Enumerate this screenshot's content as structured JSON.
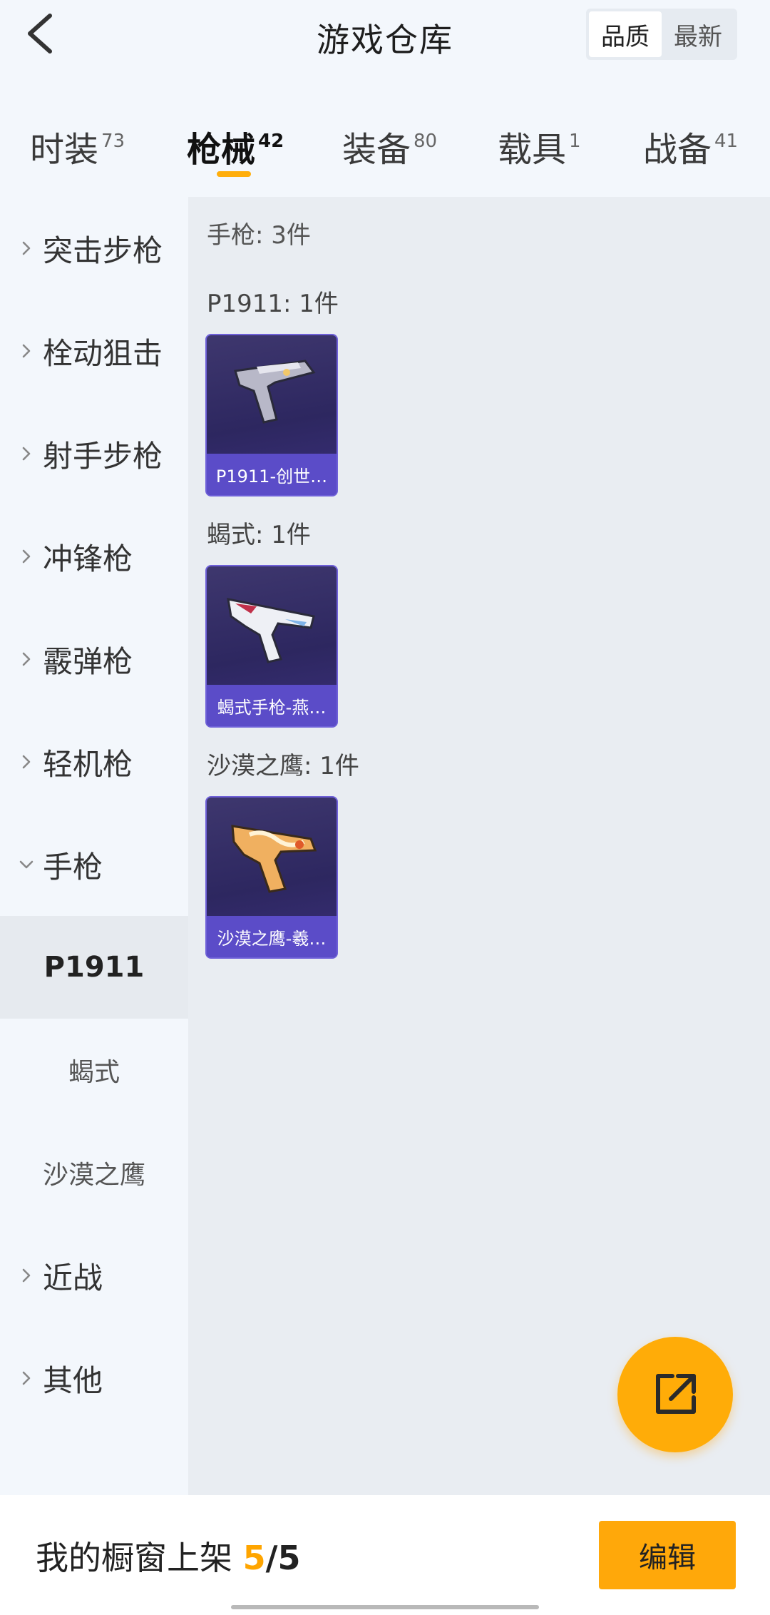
{
  "header": {
    "title": "游戏仓库",
    "sort_options": [
      "品质",
      "最新"
    ]
  },
  "tabs": [
    {
      "label": "时装",
      "count": "73"
    },
    {
      "label": "枪械",
      "count": "42"
    },
    {
      "label": "装备",
      "count": "80"
    },
    {
      "label": "载具",
      "count": "1"
    },
    {
      "label": "战备",
      "count": "41"
    }
  ],
  "sidebar": {
    "categories": [
      "突击步枪",
      "栓动狙击",
      "射手步枪",
      "冲锋枪",
      "霰弹枪",
      "轻机枪",
      "手枪"
    ],
    "subcategories": [
      "P1911",
      "蝎式",
      "沙漠之鹰"
    ],
    "bottom_categories": [
      "近战",
      "其他"
    ]
  },
  "content": {
    "section_title": "手枪: 3件",
    "groups": [
      {
        "title": "P1911: 1件",
        "item_label": "P1911-创世…"
      },
      {
        "title": "蝎式: 1件",
        "item_label": "蝎式手枪-燕…"
      },
      {
        "title": "沙漠之鹰: 1件",
        "item_label": "沙漠之鹰-羲…"
      }
    ]
  },
  "bottom_bar": {
    "showcase_label": "我的橱窗上架",
    "current": "5",
    "separator": "/",
    "total": "5",
    "edit_label": "编辑"
  },
  "colors": {
    "accent": "#ffac08",
    "card_bg": "#2d2760",
    "card_label_bg": "#5b4cc8",
    "content_bg": "#e9edf2"
  }
}
